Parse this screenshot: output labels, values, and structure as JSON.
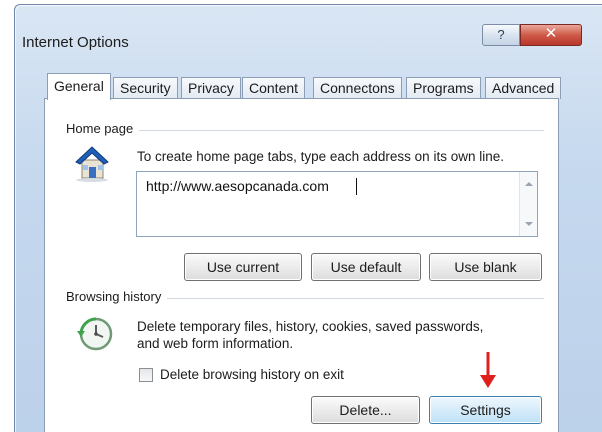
{
  "window": {
    "title": "Internet Options",
    "help_glyph": "?",
    "close_glyph": "✕"
  },
  "tabs": [
    {
      "label": "General",
      "active": true
    },
    {
      "label": "Security"
    },
    {
      "label": "Privacy"
    },
    {
      "label": "Content"
    },
    {
      "label": "Connectons"
    },
    {
      "label": "Programs"
    },
    {
      "label": "Advanced"
    }
  ],
  "home_page": {
    "group_label": "Home page",
    "icon": "house-icon",
    "description": "To create home page tabs, type each address on its own line.",
    "url_value": "http://www.aesopcanada.com",
    "buttons": {
      "use_current": "Use current",
      "use_default": "Use default",
      "use_blank": "Use blank"
    }
  },
  "browsing_history": {
    "group_label": "Browsing history",
    "icon": "history-clock-icon",
    "description_line1": "Delete temporary files, history, cookies, saved passwords,",
    "description_line2": "and web form information.",
    "checkbox_label": "Delete browsing history on exit",
    "checkbox_checked": false,
    "buttons": {
      "delete": "Delete...",
      "settings": "Settings"
    }
  },
  "annotation": {
    "arrow_color": "#e0201c",
    "points_to": "Settings"
  },
  "colors": {
    "window_frame": "#c5d8ee",
    "close_button": "#cf5a48",
    "hover_button": "#d6ecfa",
    "panel": "#ffffff"
  }
}
